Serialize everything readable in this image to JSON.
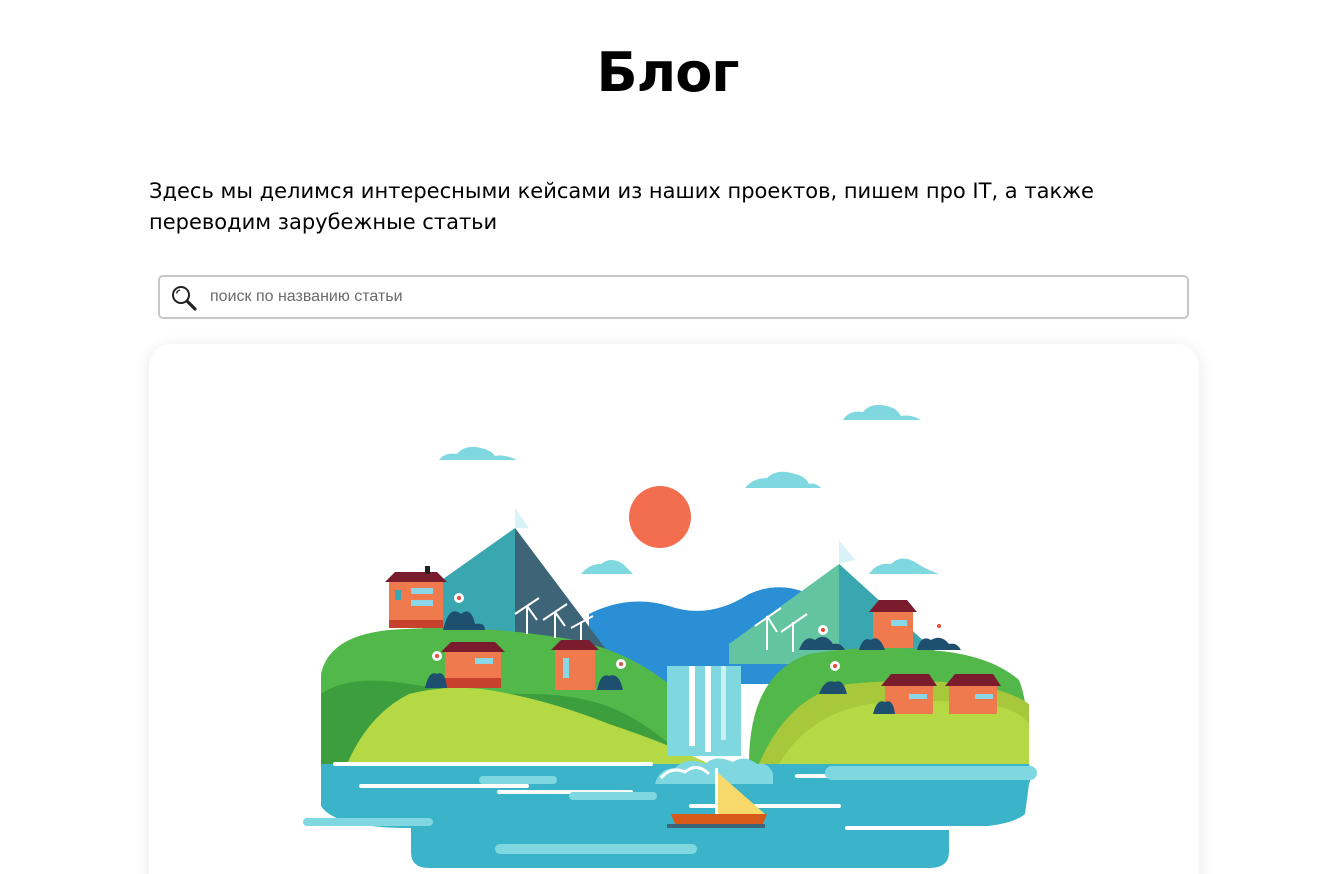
{
  "header": {
    "title": "Блог"
  },
  "intro": {
    "text": "Здесь мы делимся интересными кейсами из наших проектов, пишем про IT, а также переводим зарубежные статьи"
  },
  "search": {
    "placeholder": "поиск по названию статьи",
    "value": "",
    "icon": "search-icon"
  },
  "article_card": {
    "image": "landscape-illustration",
    "colors": {
      "sun": "#f26e4f",
      "water": "#3bb3c8",
      "grass": "#52b84a",
      "lime": "#b5d944",
      "mountain_teal": "#3aa6b0",
      "mountain_dark": "#3e6478",
      "cloud": "#7fd8e0"
    }
  }
}
